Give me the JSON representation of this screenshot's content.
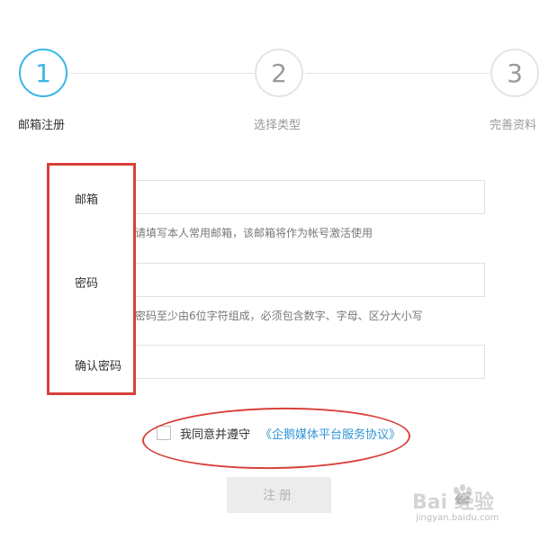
{
  "stepper": {
    "steps": [
      {
        "number": "1",
        "label": "邮箱注册",
        "active": true
      },
      {
        "number": "2",
        "label": "选择类型",
        "active": false
      },
      {
        "number": "3",
        "label": "完善资料",
        "active": false
      }
    ]
  },
  "form": {
    "fields": [
      {
        "label": "邮箱",
        "value": "",
        "placeholder": "",
        "hint": "请填写本人常用邮箱，该邮箱将作为帐号激活使用"
      },
      {
        "label": "密码",
        "value": "",
        "placeholder": "",
        "hint": "密码至少由6位字符组成，必须包含数字、字母、区分大小写"
      },
      {
        "label": "确认密码",
        "value": "",
        "placeholder": "",
        "hint": ""
      }
    ]
  },
  "agreement": {
    "checked": false,
    "text": "我同意并遵守",
    "link": "《企鹅媒体平台服务协议》"
  },
  "register_button": {
    "label": "注册",
    "enabled": false
  },
  "watermark": {
    "logo": "Bai 经验",
    "url": "jingyan.baidu.com"
  },
  "colors": {
    "accent": "#3ab6e6",
    "link": "#2f95d6",
    "annotation_red": "#d8403a",
    "disabled_button_bg": "#ececec"
  }
}
